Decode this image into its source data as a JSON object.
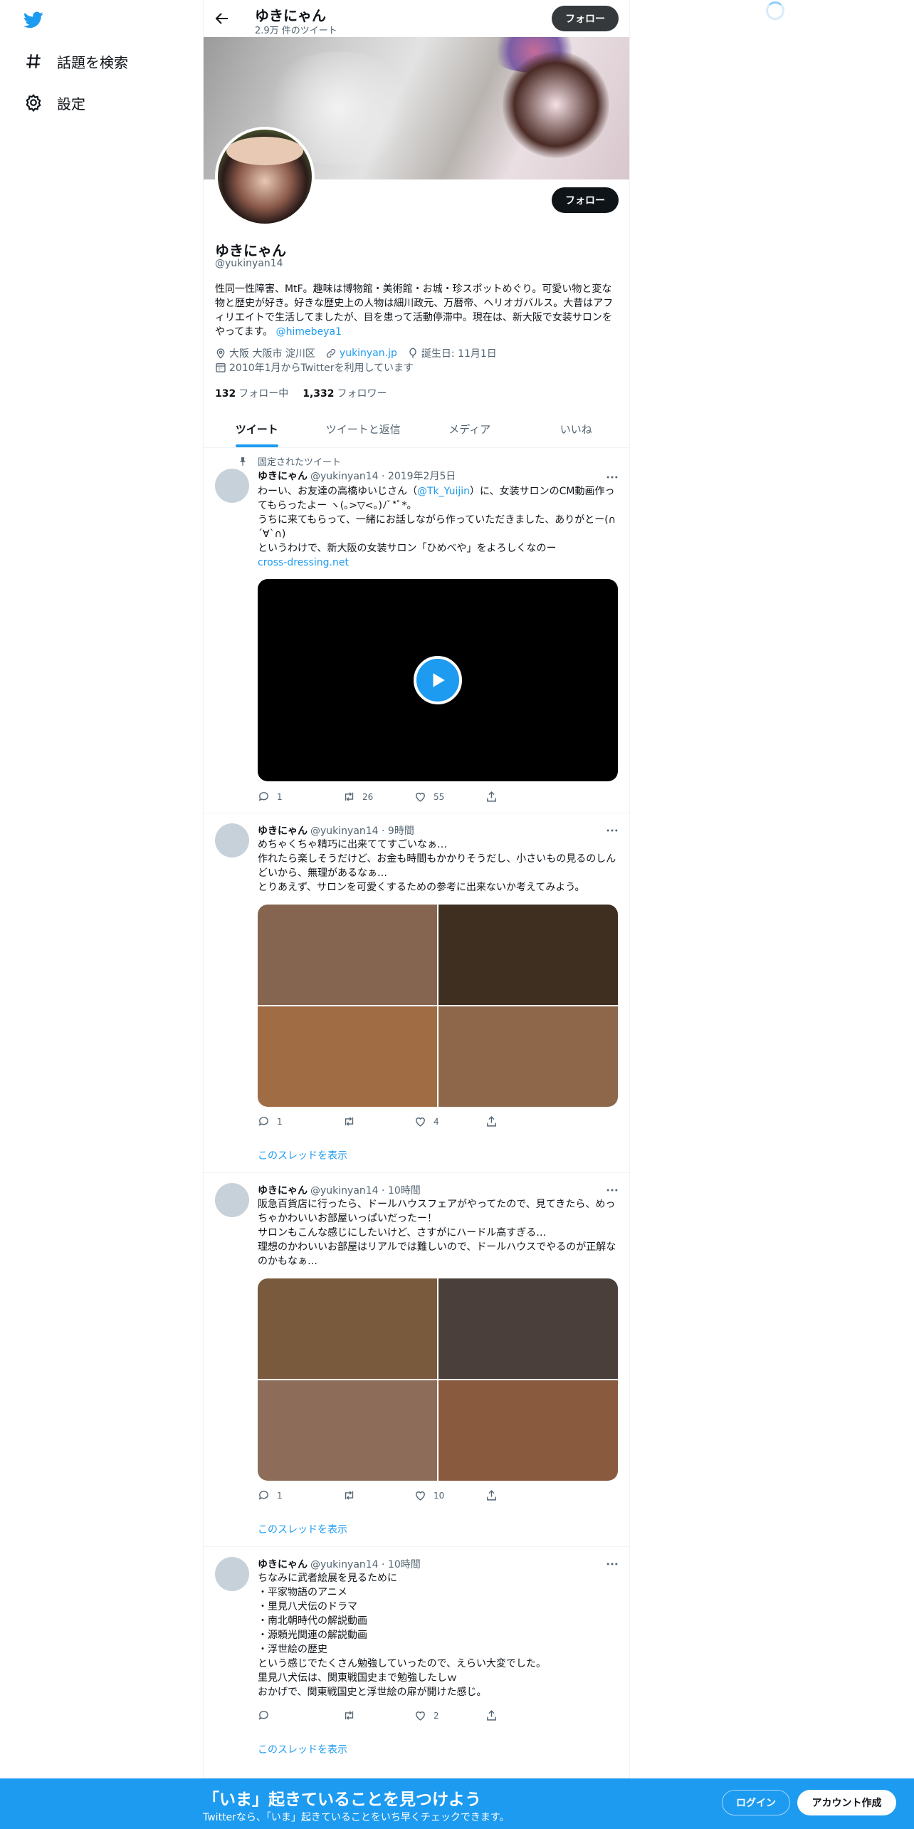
{
  "nav": {
    "items": [
      {
        "label": "話題を検索",
        "icon": "hashtag-icon"
      },
      {
        "label": "設定",
        "icon": "gear-icon"
      }
    ]
  },
  "topbar": {
    "name": "ゆきにゃん",
    "tweet_count": "2.9万 件のツイート",
    "follow_label": "フォロー"
  },
  "profile": {
    "name": "ゆきにゃん",
    "handle": "@yukinyan14",
    "follow_label": "フォロー",
    "bio": "性同一性障害、MtF。趣味は博物館・美術館・お城・珍スポットめぐり。可愛い物と変な物と歴史が好き。好きな歴史上の人物は細川政元、万暦帝、ヘリオガバルス。大昔はアフィリエイトで生活してましたが、目を患って活動停滞中。現在は、新大阪で女装サロンをやってます。",
    "bio_mention": "@himebeya1",
    "location": "大阪 大阪市 淀川区",
    "website": "yukinyan.jp",
    "birthday": "誕生日: 11月1日",
    "joined": "2010年1月からTwitterを利用しています",
    "following_count": "132",
    "following_label": "フォロー中",
    "followers_count": "1,332",
    "followers_label": "フォロワー"
  },
  "tabs": [
    "ツイート",
    "ツイートと返信",
    "メディア",
    "いいね"
  ],
  "pinned_label": "固定されたツイート",
  "tweets": [
    {
      "name": "ゆきにゃん",
      "meta": "@yukinyan14 · 2019年2月5日",
      "text_a": "わーい、お友達の高橋ゆいじさん（",
      "mention": "@Tk_Yuijin",
      "text_b": "）に、女装サロンのCM動画作ってもらったよー ヽ(｡>▽<｡)ﾉﾞ*ﾟ*。\nうちに来てもらって、一緒にお話しながら作っていただきました、ありがとー(∩´∀`∩)\nというわけで、新大阪の女装サロン「ひめべや」をよろしくなのー",
      "link": "cross-dressing.net",
      "replies": "1",
      "retweets": "26",
      "likes": "55"
    },
    {
      "name": "ゆきにゃん",
      "meta": "@yukinyan14 · 9時間",
      "text": "めちゃくちゃ精巧に出来ててすごいなぁ…\n作れたら楽しそうだけど、お金も時間もかかりそうだし、小さいもの見るのしんどいから、無理があるなぁ…\nとりあえず、サロンを可愛くするための参考に出来ないか考えてみよう。",
      "replies": "1",
      "retweets": "",
      "likes": "4",
      "thread": "このスレッドを表示",
      "image_colors": [
        "#856550",
        "#3f2f20",
        "#a06c44",
        "#8e674a"
      ]
    },
    {
      "name": "ゆきにゃん",
      "meta": "@yukinyan14 · 10時間",
      "text": "阪急百貨店に行ったら、ドールハウスフェアがやってたので、見てきたら、めっちゃかわいいお部屋いっぱいだったー！\nサロンもこんな感じにしたいけど、さすがにハードル高すぎる…\n理想のかわいいお部屋はリアルでは難しいので、ドールハウスでやるのが正解なのかもなぁ…",
      "replies": "1",
      "retweets": "",
      "likes": "10",
      "thread": "このスレッドを表示",
      "image_colors": [
        "#7a5a3d",
        "#4a3f3b",
        "#8d6d5a",
        "#8a5a3e"
      ]
    },
    {
      "name": "ゆきにゃん",
      "meta": "@yukinyan14 · 10時間",
      "text": "ちなみに武者絵展を見るために\n・平家物語のアニメ\n・里見八犬伝のドラマ\n・南北朝時代の解説動画\n・源頼光関連の解説動画\n・浮世絵の歴史\nという感じでたくさん勉強していったので、えらい大変でした。\n里見八犬伝は、関東戦国史まで勉強したしｗ\nおかげで、関東戦国史と浮世絵の扉が開けた感じ。",
      "replies": "",
      "retweets": "",
      "likes": "2",
      "thread": "このスレッドを表示"
    }
  ],
  "bottombar": {
    "title": "「いま」起きていることを見つけよう",
    "subtitle": "Twitterなら、「いま」起きていることをいち早くチェックできます。",
    "login_label": "ログイン",
    "signup_label": "アカウント作成"
  },
  "colors": {
    "accent": "#1d9bf0",
    "dark_button": "#0f1419"
  }
}
